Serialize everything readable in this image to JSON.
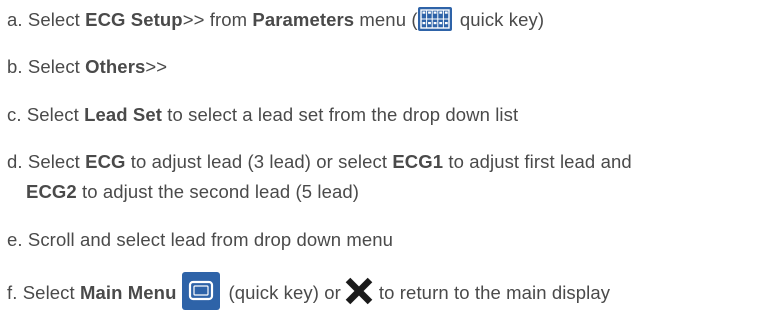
{
  "steps": [
    {
      "marker": "a.",
      "t1": "Select ",
      "b1": "ECG Setup",
      "t2": ">> from ",
      "b2": "Parameters",
      "t3": " menu (",
      "t4": " quick key)",
      "icon": "parameters-grid-icon"
    },
    {
      "marker": "b.",
      "t1": "Select ",
      "b1": "Others",
      "t2": ">>"
    },
    {
      "marker": "c.",
      "t1": "Select ",
      "b1": "Lead Set",
      "t2": " to select a lead set from the drop down list"
    },
    {
      "marker": "d.",
      "t1": "Select ",
      "b1": "ECG",
      "t2": " to adjust lead (3 lead) or select ",
      "b2": "ECG1",
      "t3": " to adjust first lead and",
      "cont_b": "ECG2",
      "cont_t": " to adjust the second lead (5 lead)"
    },
    {
      "marker": "e.",
      "t1": "Scroll and select lead from drop down menu"
    },
    {
      "marker": "f.",
      "t1": "Select ",
      "b1": "Main Menu",
      "t2": "(quick key) or",
      "t3": "to return to the main display",
      "icon1": "main-menu-icon",
      "icon2": "close-x-icon"
    }
  ],
  "colors": {
    "text": "#4a4a4a",
    "icon_bg": "#2e63a8",
    "icon_fg": "#ffffff",
    "x_mark": "#1a1a1a"
  }
}
